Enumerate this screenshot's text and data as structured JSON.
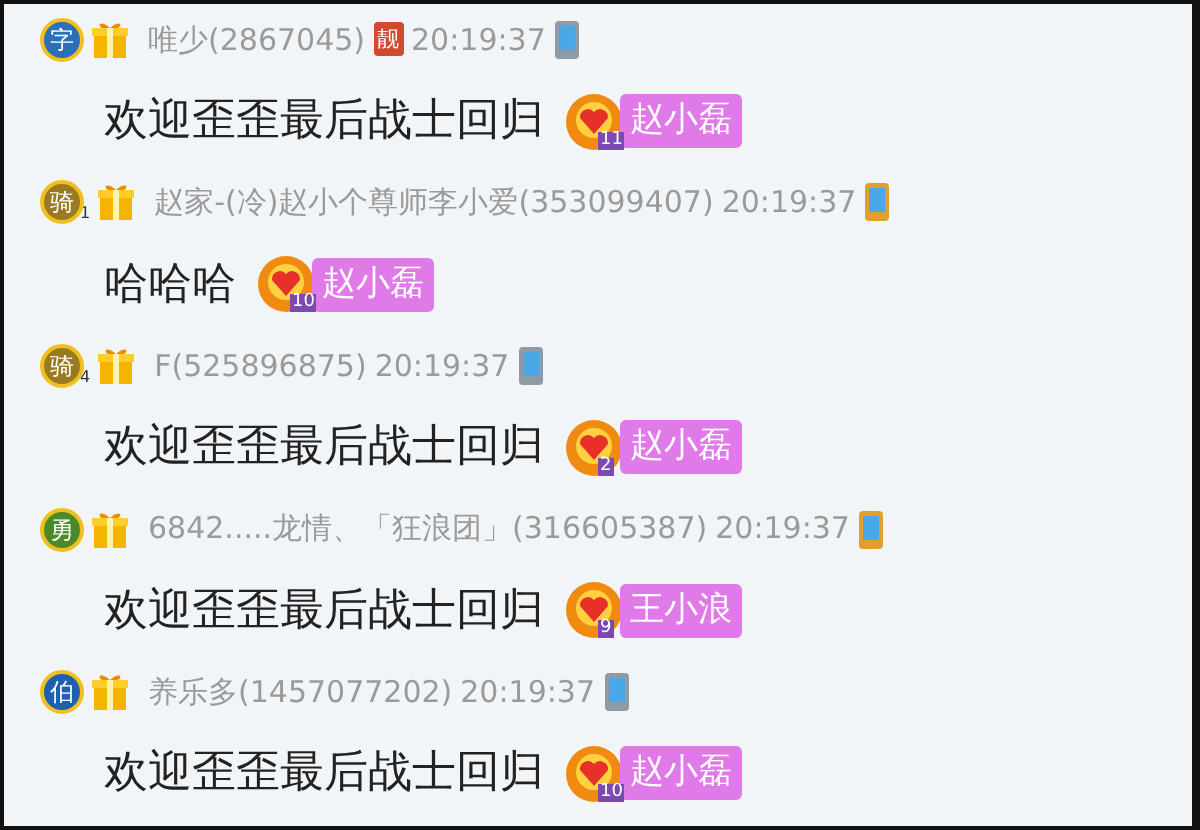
{
  "messages": [
    {
      "rank": "字",
      "name": "唯少(2867045)",
      "tag": "靓",
      "time": "20:19:37",
      "color": "#8e9aa6",
      "text": "欢迎歪歪最后战士回归",
      "gift": {
        "count": "11",
        "to": "赵小磊"
      }
    },
    {
      "rank": "骑",
      "rank_level": "1",
      "name": "赵家-(冷)赵小个尊师李小爱(353099407)",
      "time": "20:19:37",
      "color": "#e0a030",
      "text": "哈哈哈",
      "gift": {
        "count": "10",
        "to": "赵小磊"
      }
    },
    {
      "rank": "骑",
      "rank_level": "4",
      "name": "F(525896875)",
      "time": "20:19:37",
      "color": "#8e9aa6",
      "text": "欢迎歪歪最后战士回归",
      "gift": {
        "count": "2",
        "to": "赵小磊"
      }
    },
    {
      "rank": "勇",
      "name": "6842.....龙情、「狂浪团」(316605387)",
      "time": "20:19:37",
      "color": "#e0a030",
      "text": "欢迎歪歪最后战士回归",
      "gift": {
        "count": "9",
        "to": "王小浪"
      }
    },
    {
      "rank": "伯",
      "name": "养乐多(1457077202)",
      "time": "20:19:37",
      "color": "#8e9aa6",
      "text": "欢迎歪歪最后战士回归",
      "gift": {
        "count": "10",
        "to": "赵小磊"
      }
    }
  ]
}
